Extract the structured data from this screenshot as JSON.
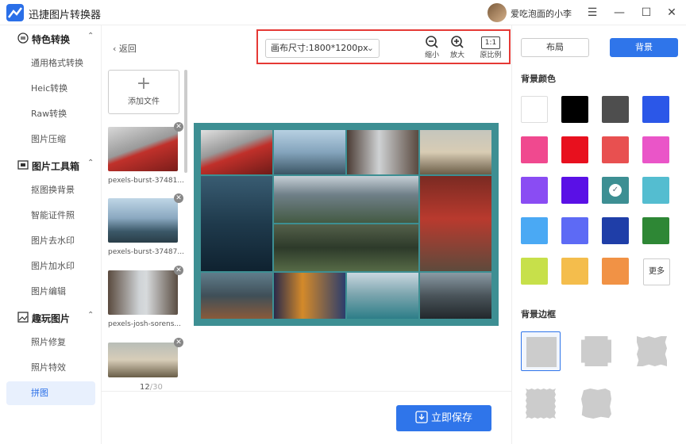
{
  "app": {
    "title": "迅捷图片转换器"
  },
  "user": {
    "name": "爱吃泡面的小李"
  },
  "window": {
    "menu": "☰",
    "min": "—",
    "max": "☐",
    "close": "✕"
  },
  "sidebar": {
    "groups": [
      {
        "label": "特色转换",
        "chevron": "⌃"
      },
      {
        "label": "图片工具箱",
        "chevron": "⌃"
      },
      {
        "label": "趣玩图片",
        "chevron": "⌃"
      }
    ],
    "items": [
      "通用格式转换",
      "Heic转换",
      "Raw转换",
      "图片压缩",
      "抠图换背景",
      "智能证件照",
      "图片去水印",
      "图片加水印",
      "图片编辑",
      "照片修复",
      "照片特效",
      "拼图"
    ]
  },
  "files": {
    "back_label": "返回",
    "add_label": "添加文件",
    "names": [
      "pexels-burst-37481...",
      "pexels-burst-37487...",
      "pexels-josh-sorens..."
    ],
    "count_current": "12",
    "count_total": "/30"
  },
  "toolbar": {
    "canvas_size": "画布尺寸:1800*1200px",
    "zoom_out": "缩小",
    "zoom_in": "放大",
    "ratio_icon": "1:1",
    "ratio_label": "原比例"
  },
  "right_panel": {
    "tab_layout": "布局",
    "tab_background": "背景",
    "bg_color_title": "背景颜色",
    "colors": [
      "#ffffff",
      "#000000",
      "#4e4e4e",
      "#2b57e8",
      "#f0498f",
      "#e8101e",
      "#e85050",
      "#ea55c8",
      "#8a4cf3",
      "#5a10e6",
      "#3d8f93",
      "#54bdd0",
      "#4aa9f4",
      "#5d6af5",
      "#1f3ea8",
      "#2e8735",
      "#c7e04a",
      "#f4bd4c",
      "#f19245"
    ],
    "selected_color": "#3d8f93",
    "more_label": "更多",
    "border_title": "背景边框"
  },
  "save": {
    "label": "立即保存"
  }
}
